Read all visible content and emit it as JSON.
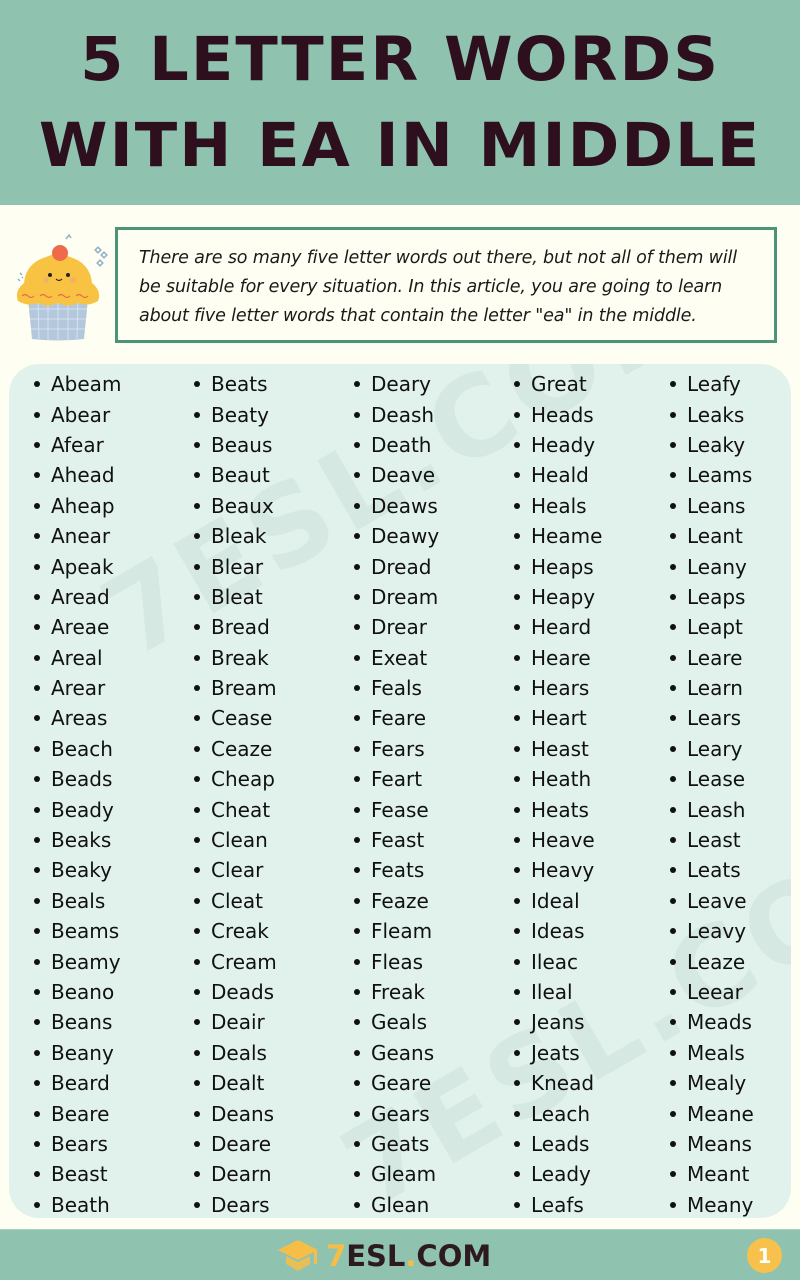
{
  "header": {
    "title_line1": "5 LETTER WORDS",
    "title_line2": "WITH EA IN MIDDLE"
  },
  "intro": {
    "text": "There are so many five letter words out there, but not all of them will be suitable for every situation. In this article, you are going to learn about five letter words that contain the letter \"ea\" in the middle."
  },
  "word_columns": [
    [
      "Abeam",
      "Abear",
      "Afear",
      "Ahead",
      "Aheap",
      "Anear",
      "Apeak",
      "Aread",
      "Areae",
      "Areal",
      "Arear",
      "Areas",
      "Beach",
      "Beads",
      "Beady",
      "Beaks",
      "Beaky",
      "Beals",
      "Beams",
      "Beamy",
      "Beano",
      "Beans",
      "Beany",
      "Beard",
      "Beare",
      "Bears",
      "Beast",
      "Beath"
    ],
    [
      "Beats",
      "Beaty",
      "Beaus",
      "Beaut",
      "Beaux",
      "Bleak",
      "Blear",
      "Bleat",
      "Bread",
      "Break",
      "Bream",
      "Cease",
      "Ceaze",
      "Cheap",
      "Cheat",
      "Clean",
      "Clear",
      "Cleat",
      "Creak",
      "Cream",
      "Deads",
      "Deair",
      "Deals",
      "Dealt",
      "Deans",
      "Deare",
      "Dearn",
      "Dears"
    ],
    [
      "Deary",
      "Deash",
      "Death",
      "Deave",
      "Deaws",
      "Deawy",
      "Dread",
      "Dream",
      "Drear",
      "Exeat",
      "Feals",
      "Feare",
      "Fears",
      "Feart",
      "Fease",
      "Feast",
      "Feats",
      "Feaze",
      "Fleam",
      "Fleas",
      "Freak",
      "Geals",
      "Geans",
      "Geare",
      "Gears",
      "Geats",
      "Gleam",
      "Glean"
    ],
    [
      "Great",
      "Heads",
      "Heady",
      "Heald",
      "Heals",
      "Heame",
      "Heaps",
      "Heapy",
      "Heard",
      "Heare",
      "Hears",
      "Heart",
      "Heast",
      "Heath",
      "Heats",
      "Heave",
      "Heavy",
      "Ideal",
      "Ideas",
      "Ileac",
      "Ileal",
      "Jeans",
      "Jeats",
      "Knead",
      "Leach",
      "Leads",
      "Leady",
      "Leafs"
    ],
    [
      "Leafy",
      "Leaks",
      "Leaky",
      "Leams",
      "Leans",
      "Leant",
      "Leany",
      "Leaps",
      "Leapt",
      "Leare",
      "Learn",
      "Lears",
      "Leary",
      "Lease",
      "Leash",
      "Least",
      "Leats",
      "Leave",
      "Leavy",
      "Leaze",
      "Leear",
      "Meads",
      "Meals",
      "Mealy",
      "Meane",
      "Means",
      "Meant",
      "Meany"
    ]
  ],
  "watermark": "7ESL.COM",
  "footer": {
    "logo_seven": "7",
    "logo_esl": "ESL",
    "logo_dot": ".",
    "logo_com": "COM",
    "page_number": "1"
  },
  "colors": {
    "header_bg": "#8fc3b0",
    "title_text": "#2e0f1d",
    "page_bg": "#fefef2",
    "panel_bg": "#e1f2ec",
    "intro_border": "#4c9478",
    "accent_yellow": "#f7c14b"
  }
}
